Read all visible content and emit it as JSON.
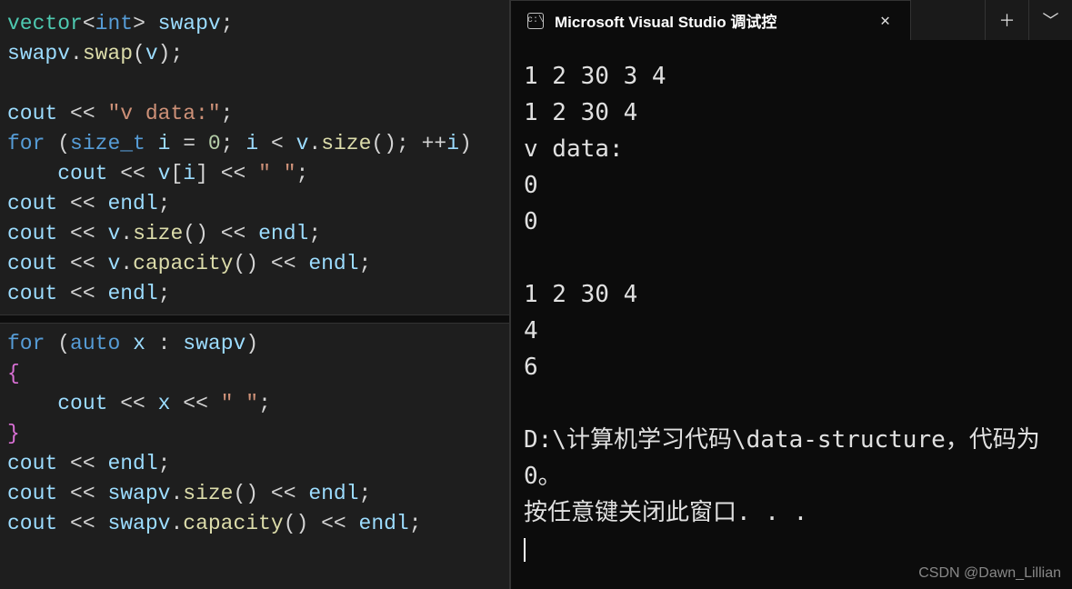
{
  "editor": {
    "block1": {
      "l1": {
        "p1": "vector",
        "p2": "<",
        "p3": "int",
        "p4": "> ",
        "p5": "swapv",
        "p6": ";"
      },
      "l2": {
        "p1": "swapv",
        "p2": ".",
        "p3": "swap",
        "p4": "(",
        "p5": "v",
        "p6": ");"
      },
      "l3": "",
      "l4": {
        "p1": "cout",
        "p2": " << ",
        "p3": "\"v data:\"",
        "p4": ";"
      },
      "l5": {
        "p1": "for",
        "p2": " (",
        "p3": "size_t",
        "p4": " ",
        "p5": "i",
        "p6": " = ",
        "p7": "0",
        "p8": "; ",
        "p9": "i",
        "p10": " < ",
        "p11": "v",
        "p12": ".",
        "p13": "size",
        "p14": "(); ++",
        "p15": "i",
        "p16": ")"
      },
      "l6": {
        "p1": "    ",
        "p2": "cout",
        "p3": " << ",
        "p4": "v",
        "p5": "[",
        "p6": "i",
        "p7": "] << ",
        "p8": "\" \"",
        "p9": ";"
      },
      "l7": {
        "p1": "cout",
        "p2": " << ",
        "p3": "endl",
        "p4": ";"
      },
      "l8": {
        "p1": "cout",
        "p2": " << ",
        "p3": "v",
        "p4": ".",
        "p5": "size",
        "p6": "() << ",
        "p7": "endl",
        "p8": ";"
      },
      "l9": {
        "p1": "cout",
        "p2": " << ",
        "p3": "v",
        "p4": ".",
        "p5": "capacity",
        "p6": "() << ",
        "p7": "endl",
        "p8": ";"
      },
      "l10": {
        "p1": "cout",
        "p2": " << ",
        "p3": "endl",
        "p4": ";"
      }
    },
    "block2": {
      "l1": {
        "p1": "for",
        "p2": " (",
        "p3": "auto",
        "p4": " ",
        "p5": "x",
        "p6": " : ",
        "p7": "swapv",
        "p8": ")"
      },
      "l2": "{",
      "l3": {
        "p1": "    ",
        "p2": "cout",
        "p3": " << ",
        "p4": "x",
        "p5": " << ",
        "p6": "\" \"",
        "p7": ";"
      },
      "l4": "}",
      "l5": {
        "p1": "cout",
        "p2": " << ",
        "p3": "endl",
        "p4": ";"
      },
      "l6": {
        "p1": "cout",
        "p2": " << ",
        "p3": "swapv",
        "p4": ".",
        "p5": "size",
        "p6": "() << ",
        "p7": "endl",
        "p8": ";"
      },
      "l7": {
        "p1": "cout",
        "p2": " << ",
        "p3": "swapv",
        "p4": ".",
        "p5": "capacity",
        "p6": "() << ",
        "p7": "endl",
        "p8": ";"
      }
    }
  },
  "terminal": {
    "tab_icon_text": "c:\\",
    "tab_title": "Microsoft Visual Studio 调试控",
    "output": "1 2 30 3 4 \n1 2 30 4 \nv data:\n0\n0\n\n1 2 30 4 \n4\n6\n\nD:\\计算机学习代码\\data-structure，代码为 0。\n按任意键关闭此窗口. . .\n"
  },
  "watermark": "CSDN @Dawn_Lillian"
}
